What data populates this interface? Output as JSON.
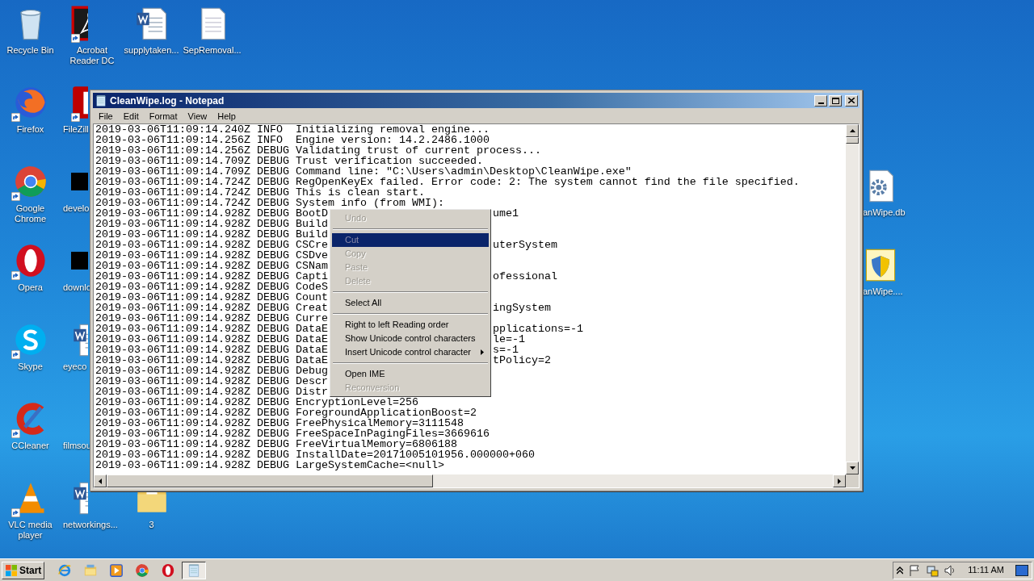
{
  "desktop": {
    "rows": [
      [
        {
          "kind": "bin",
          "label": "Recycle Bin",
          "shortcut": false
        },
        {
          "kind": "pdf",
          "label": "Acrobat Reader DC",
          "shortcut": true
        },
        {
          "kind": "word",
          "label": "supplytaken...",
          "shortcut": false
        },
        {
          "kind": "text",
          "label": "SepRemoval...",
          "shortcut": false
        }
      ],
      [
        {
          "kind": "firefox",
          "label": "Firefox",
          "shortcut": true
        },
        {
          "kind": "filezilla",
          "label": "FileZill",
          "shortcut": true
        }
      ],
      [
        {
          "kind": "chrome",
          "label": "Google Chrome",
          "shortcut": true
        },
        {
          "kind": "black",
          "label": "develo",
          "shortcut": false
        }
      ],
      [
        {
          "kind": "opera",
          "label": "Opera",
          "shortcut": true
        },
        {
          "kind": "black",
          "label": "downlo",
          "shortcut": false
        }
      ],
      [
        {
          "kind": "skype",
          "label": "Skype",
          "shortcut": true
        },
        {
          "kind": "word",
          "label": "eyeco",
          "shortcut": false
        }
      ],
      [
        {
          "kind": "ccleaner",
          "label": "CCleaner",
          "shortcut": true
        },
        {
          "kind": "none",
          "label": "filmsou",
          "shortcut": false
        }
      ],
      [
        {
          "kind": "vlc",
          "label": "VLC media player",
          "shortcut": true
        },
        {
          "kind": "word",
          "label": "networkings...",
          "shortcut": false
        },
        {
          "kind": "folder",
          "label": "3",
          "shortcut": false
        }
      ]
    ],
    "right_icons": [
      {
        "kind": "gear",
        "label": "anWipe.db"
      },
      {
        "kind": "shield",
        "label": "anWipe...."
      }
    ]
  },
  "window": {
    "title": "CleanWipe.log - Notepad",
    "menu": [
      "File",
      "Edit",
      "Format",
      "View",
      "Help"
    ],
    "lines": [
      {
        "text": "2019-03-06T11:09:14.240Z INFO  Initializing removal engine..."
      },
      {
        "text": "2019-03-06T11:09:14.256Z INFO  Engine version: 14.2.2486.1000"
      },
      {
        "text": "2019-03-06T11:09:14.256Z DEBUG Validating trust of current process..."
      },
      {
        "text": "2019-03-06T11:09:14.709Z DEBUG Trust verification succeeded."
      },
      {
        "text": "2019-03-06T11:09:14.709Z DEBUG Command line: \"C:\\Users\\admin\\Desktop\\CleanWipe.exe\""
      },
      {
        "text": "2019-03-06T11:09:14.724Z DEBUG RegOpenKeyEx failed. Error code: 2: The system cannot find the file specified."
      },
      {
        "text": "2019-03-06T11:09:14.724Z DEBUG This is clean start."
      },
      {
        "text": "2019-03-06T11:09:14.724Z DEBUG System info (from WMI):"
      },
      {
        "text": "2019-03-06T11:09:14.928Z DEBUG BootD",
        "tail": "ume1"
      },
      {
        "text": "2019-03-06T11:09:14.928Z DEBUG Build"
      },
      {
        "text": "2019-03-06T11:09:14.928Z DEBUG Build"
      },
      {
        "text": "2019-03-06T11:09:14.928Z DEBUG CSCre",
        "tail": "uterSystem"
      },
      {
        "text": "2019-03-06T11:09:14.928Z DEBUG CSDve"
      },
      {
        "text": "2019-03-06T11:09:14.928Z DEBUG CSNam"
      },
      {
        "text": "2019-03-06T11:09:14.928Z DEBUG Capti",
        "tail": "ofessional"
      },
      {
        "text": "2019-03-06T11:09:14.928Z DEBUG CodeS"
      },
      {
        "text": "2019-03-06T11:09:14.928Z DEBUG Count"
      },
      {
        "text": "2019-03-06T11:09:14.928Z DEBUG Creat",
        "tail": "ingSystem"
      },
      {
        "text": "2019-03-06T11:09:14.928Z DEBUG Curre"
      },
      {
        "text": "2019-03-06T11:09:14.928Z DEBUG DataE",
        "tail": "pplications=-1"
      },
      {
        "text": "2019-03-06T11:09:14.928Z DEBUG DataE",
        "tail": "le=-1"
      },
      {
        "text": "2019-03-06T11:09:14.928Z DEBUG DataE",
        "tail": "s=-1"
      },
      {
        "text": "2019-03-06T11:09:14.928Z DEBUG DataE",
        "tail": "tPolicy=2"
      },
      {
        "text": "2019-03-06T11:09:14.928Z DEBUG Debug"
      },
      {
        "text": "2019-03-06T11:09:14.928Z DEBUG Descr"
      },
      {
        "text": "2019-03-06T11:09:14.928Z DEBUG Distr"
      },
      {
        "text": "2019-03-06T11:09:14.928Z DEBUG EncryptionLevel=256"
      },
      {
        "text": "2019-03-06T11:09:14.928Z DEBUG ForegroundApplicationBoost=2"
      },
      {
        "text": "2019-03-06T11:09:14.928Z DEBUG FreePhysicalMemory=3111548"
      },
      {
        "text": "2019-03-06T11:09:14.928Z DEBUG FreeSpaceInPagingFiles=3669616"
      },
      {
        "text": "2019-03-06T11:09:14.928Z DEBUG FreeVirtualMemory=6806188"
      },
      {
        "text": "2019-03-06T11:09:14.928Z DEBUG InstallDate=20171005101956.000000+060"
      },
      {
        "text": "2019-03-06T11:09:14.928Z DEBUG LargeSystemCache=<null>"
      }
    ]
  },
  "context_menu": [
    {
      "kind": "item",
      "label": "Undo",
      "disabled": true,
      "selected": false
    },
    {
      "kind": "separator"
    },
    {
      "kind": "item",
      "label": "Cut",
      "disabled": true,
      "selected": true
    },
    {
      "kind": "item",
      "label": "Copy",
      "disabled": true,
      "selected": false
    },
    {
      "kind": "item",
      "label": "Paste",
      "disabled": true,
      "selected": false
    },
    {
      "kind": "item",
      "label": "Delete",
      "disabled": true,
      "selected": false
    },
    {
      "kind": "separator"
    },
    {
      "kind": "item",
      "label": "Select All",
      "disabled": false,
      "selected": false
    },
    {
      "kind": "separator"
    },
    {
      "kind": "item",
      "label": "Right to left Reading order",
      "disabled": false,
      "selected": false
    },
    {
      "kind": "item",
      "label": "Show Unicode control characters",
      "disabled": false,
      "selected": false
    },
    {
      "kind": "submenu",
      "label": "Insert Unicode control character",
      "disabled": false,
      "selected": false
    },
    {
      "kind": "separator"
    },
    {
      "kind": "item",
      "label": "Open IME",
      "disabled": false,
      "selected": false
    },
    {
      "kind": "item",
      "label": "Reconversion",
      "disabled": true,
      "selected": false
    }
  ],
  "taskbar": {
    "start": "Start",
    "apps": [
      {
        "kind": "ie",
        "selected": false
      },
      {
        "kind": "explorer",
        "selected": false
      },
      {
        "kind": "media",
        "selected": false
      },
      {
        "kind": "chrome",
        "selected": false
      },
      {
        "kind": "opera",
        "selected": false
      },
      {
        "kind": "notepad",
        "selected": true
      }
    ],
    "clock": "11:11 AM"
  }
}
